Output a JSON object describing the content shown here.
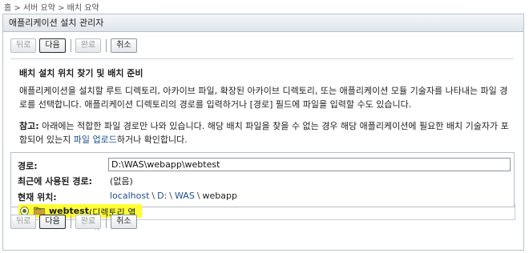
{
  "breadcrumb": "홈 > 서버 요약 > 배치 요약",
  "panel_title": "애플리케이션 설치 관리자",
  "buttons": {
    "back": "뒤로",
    "next": "다음",
    "finish": "완료",
    "cancel": "취소"
  },
  "section_title": "배치 설치 위치 찾기 및 배치 준비",
  "description": "애플리케이션을 설치할 루트 디렉토리, 아카이브 파일, 확장된 아카이브 디렉토리, 또는 애플리케이션 모듈 기술자를 나타내는 파일 경로를 선택합니다. 애플리케이션 디렉토리의 경로를 입력하거나 [경로] 필드에 파일을 입력할 수도 있습니다.",
  "note": {
    "label": "참고:",
    "text_before": " 아래에는 적합한 파일 경로만 나와 있습니다. 해당 배치 파일을 찾을 수 없는 경우 해당 애플리케이션에 필요한 배치 기술자가 포함되어 있는지 ",
    "link": "파일 업로드",
    "text_after": "하거나 확인합니다."
  },
  "form": {
    "path_label": "경로:",
    "path_value": "D:\\WAS\\webapp\\webtest",
    "recent_label": "최근에 사용된 경로:",
    "recent_value": "(없음)",
    "location_label": "현재 위치:",
    "location": [
      "localhost",
      "D:",
      "WAS",
      "webapp"
    ],
    "location_sep": "\\"
  },
  "selection": {
    "name": "webtest",
    "sub": "(디렉토리 열기)"
  },
  "colors": {
    "highlight": "#ffff33",
    "link": "#1d4f91"
  }
}
